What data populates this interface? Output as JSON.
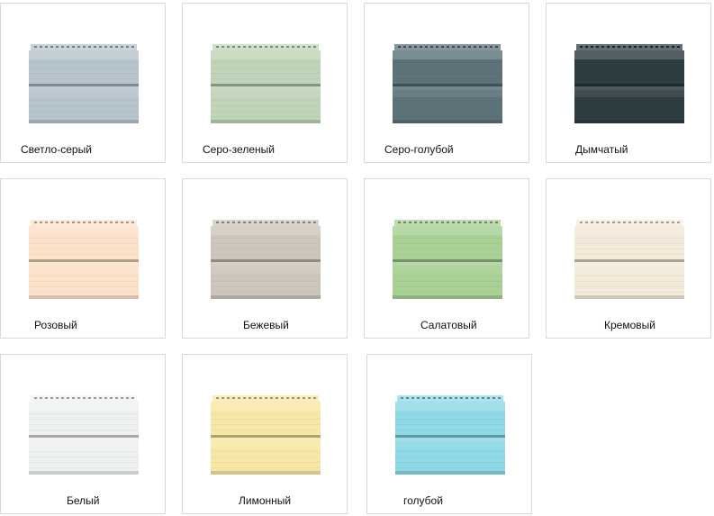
{
  "swatches": [
    {
      "label": "Светло-серый",
      "color": "#b6c4cc"
    },
    {
      "label": "Серо-зеленый",
      "color": "#bfd4b8"
    },
    {
      "label": "Серо-голубой",
      "color": "#5d7279"
    },
    {
      "label": "Дымчатый",
      "color": "#2e3d41"
    },
    {
      "label": "Розовый",
      "color": "#fbe1c9"
    },
    {
      "label": "Бежевый",
      "color": "#cdc6bb"
    },
    {
      "label": "Салатовый",
      "color": "#a9d095"
    },
    {
      "label": "Кремовый",
      "color": "#f3ead9"
    },
    {
      "label": "Белый",
      "color": "#eef0f1"
    },
    {
      "label": "Лимонный",
      "color": "#f7e7a6"
    },
    {
      "label": "голубой",
      "color": "#8fd8e6"
    }
  ]
}
